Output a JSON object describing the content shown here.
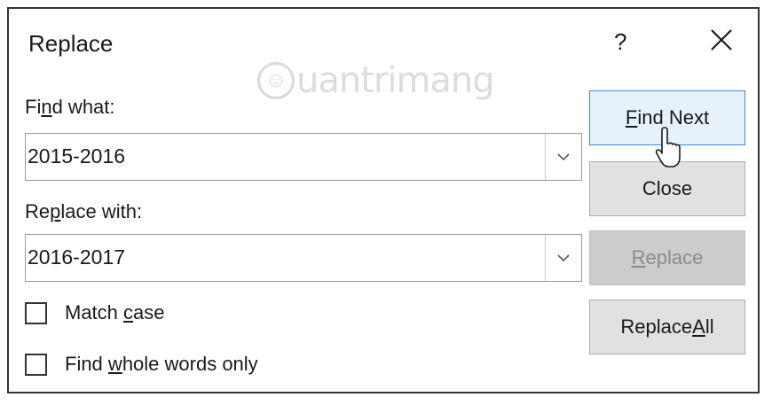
{
  "dialog": {
    "title": "Replace",
    "help_label": "?",
    "watermark": "uantrimang"
  },
  "find": {
    "label_pre": "Fi",
    "label_underline": "n",
    "label_post": "d what:",
    "value": "2015-2016"
  },
  "replace": {
    "label_pre": "Re",
    "label_underline": "p",
    "label_post": "lace with:",
    "value": "2016-2017"
  },
  "options": {
    "match_case": {
      "pre": "Match ",
      "underline": "c",
      "post": "ase",
      "checked": false
    },
    "whole_words": {
      "pre": "Find ",
      "underline": "w",
      "post": "hole words only",
      "checked": false
    }
  },
  "buttons": {
    "find_next": {
      "underline": "F",
      "post": "ind Next"
    },
    "close": "Close",
    "replace": {
      "underline": "R",
      "post": "eplace"
    },
    "replace_all": {
      "pre": "Replace ",
      "underline": "A",
      "post": "ll"
    }
  },
  "icons": {
    "help": "help-icon",
    "close": "close-icon",
    "dropdown": "chevron-down-icon",
    "cursor": "pointer-cursor-icon"
  },
  "colors": {
    "primary_button_bg": "#e5f1fb",
    "primary_button_border": "#3c8ce0",
    "button_bg": "#e1e1e1",
    "disabled_bg": "#cccccc",
    "disabled_text": "#8a8a8a"
  }
}
